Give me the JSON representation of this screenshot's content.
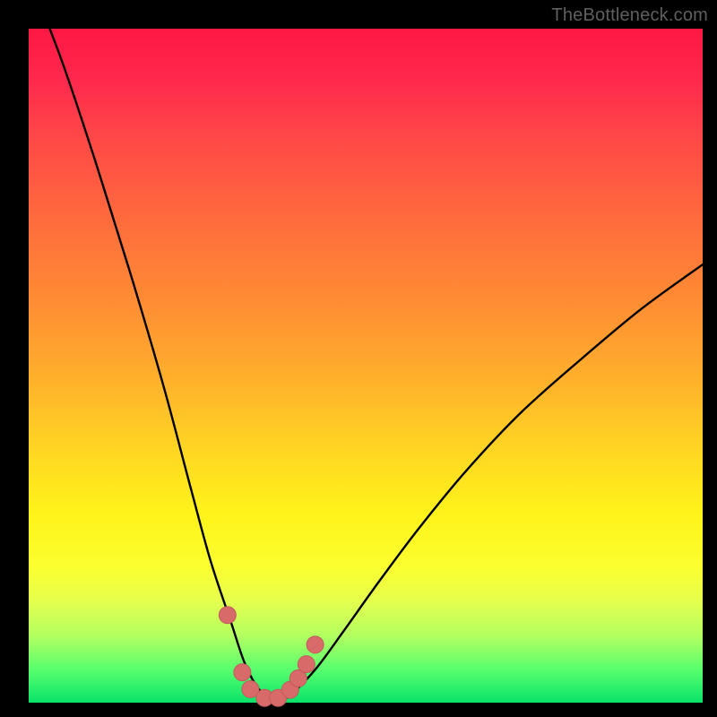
{
  "watermark": "TheBottleneck.com",
  "colors": {
    "curve": "#000000",
    "marker_fill": "#d96a6a",
    "marker_stroke": "#c05b5b",
    "gradient_top": "#ff1744",
    "gradient_mid": "#fff31a",
    "gradient_bottom": "#09e36b"
  },
  "chart_data": {
    "type": "line",
    "title": "",
    "xlabel": "",
    "ylabel": "",
    "xlim": [
      0,
      100
    ],
    "ylim": [
      0,
      100
    ],
    "grid": false,
    "legend": false,
    "series": [
      {
        "name": "bottleneck-curve",
        "x": [
          0,
          5,
          10,
          15,
          20,
          24,
          27,
          30,
          32,
          34,
          36,
          38,
          40,
          43,
          47,
          52,
          58,
          65,
          73,
          82,
          91,
          100
        ],
        "values": [
          108,
          95,
          80,
          64,
          47,
          32,
          21,
          12,
          6,
          2.2,
          0.6,
          0.6,
          2.2,
          5.5,
          11,
          18,
          26,
          34.5,
          43,
          51,
          58.5,
          65
        ]
      },
      {
        "name": "markers",
        "x": [
          29.5,
          31.7,
          32.9,
          35.0,
          37.0,
          38.8,
          40.0,
          41.2,
          42.5
        ],
        "values": [
          13.0,
          4.5,
          2.0,
          0.7,
          0.7,
          1.9,
          3.6,
          5.7,
          8.6
        ]
      }
    ]
  }
}
